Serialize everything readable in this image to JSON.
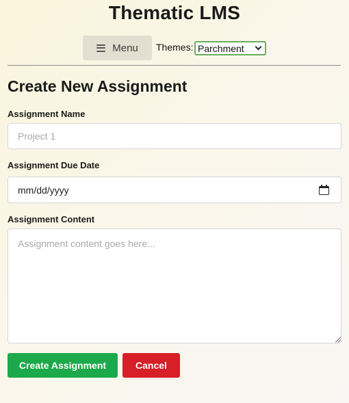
{
  "app": {
    "title": "Thematic LMS"
  },
  "nav": {
    "menu_label": "Menu",
    "menu_icon": "hamburger-icon",
    "themes_label": "Themes:",
    "theme_selected": "Parchment"
  },
  "page": {
    "title": "Create New Assignment"
  },
  "form": {
    "name": {
      "label": "Assignment Name",
      "value": "",
      "placeholder": "Project 1"
    },
    "due_date": {
      "label": "Assignment Due Date",
      "display": "mm/dd/yyyy",
      "icon": "calendar-icon"
    },
    "content": {
      "label": "Assignment Content",
      "value": "",
      "placeholder": "Assignment content goes here..."
    }
  },
  "actions": {
    "create_label": "Create Assignment",
    "cancel_label": "Cancel"
  },
  "colors": {
    "create": "#1ca94b",
    "cancel": "#d61f26",
    "select_border": "#6aab5e",
    "menu_bg": "#e3dfd0"
  }
}
